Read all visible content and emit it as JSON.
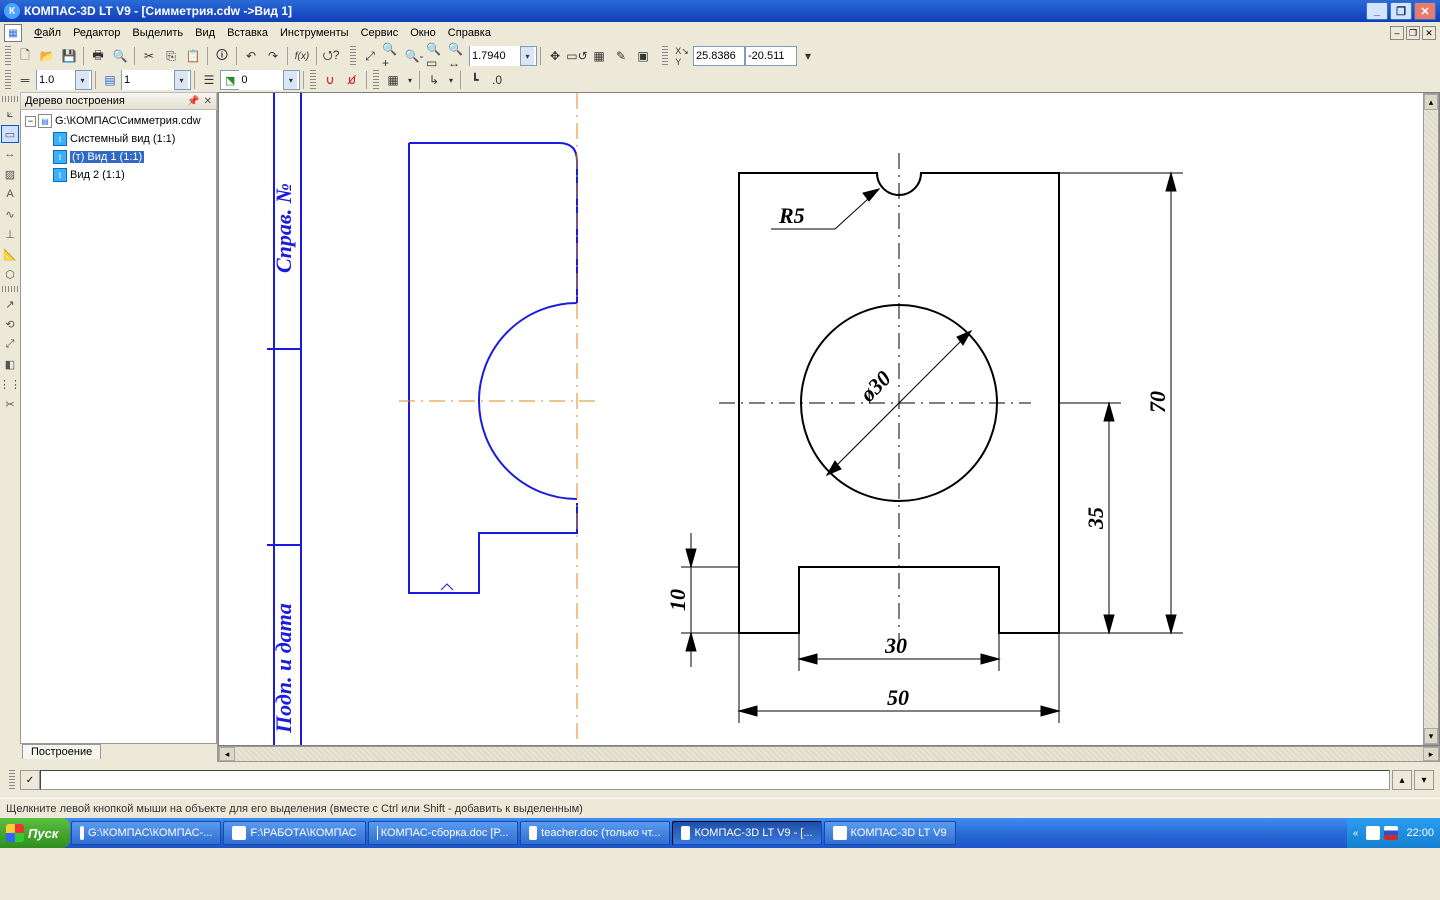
{
  "title": {
    "app": "КОМПАС-3D LT V9",
    "doc": "[Симметрия.cdw ->Вид 1]"
  },
  "menu": {
    "file": "Файл",
    "edit": "Редактор",
    "select": "Выделить",
    "view": "Вид",
    "insert": "Вставка",
    "tools": "Инструменты",
    "service": "Сервис",
    "window": "Окно",
    "help": "Справка"
  },
  "toolbar": {
    "zoom_value": "1.7940",
    "coord_label": "XY",
    "coord_x": "25.8386",
    "coord_y": "-20.511",
    "linewidth": "1.0",
    "style_val": "1",
    "layer_val": "0"
  },
  "tree": {
    "title": "Дерево построения",
    "tab": "Построение",
    "doc_path": "G:\\КОМПАС\\Симметрия.cdw",
    "items": [
      {
        "label": "Системный вид (1:1)"
      },
      {
        "label": "(т) Вид 1 (1:1)",
        "selected": true
      },
      {
        "label": "Вид 2 (1:1)"
      }
    ]
  },
  "drawing": {
    "frame_text_top": "Справ. №",
    "frame_text_bot": "Подп. и дата",
    "dims": {
      "r5": "R5",
      "d30": "ø30",
      "w50": "50",
      "w30": "30",
      "h70": "70",
      "h35": "35",
      "h10": "10"
    }
  },
  "status": {
    "hint": "Щелкните левой кнопкой мыши на объекте для его выделения (вместе с Ctrl или Shift - добавить к выделенным)"
  },
  "taskbar": {
    "start": "Пуск",
    "items": [
      {
        "label": "G:\\КОМПАС\\КОМПАС-..."
      },
      {
        "label": "F:\\РАБОТА\\КОМПАС"
      },
      {
        "label": "КОМПАС-сборка.doc [P..."
      },
      {
        "label": "teacher.doc (только чт..."
      },
      {
        "label": "КОМПАС-3D LT V9 - [...",
        "active": true
      },
      {
        "label": "КОМПАС-3D LT V9"
      }
    ],
    "clock": "22:00"
  }
}
